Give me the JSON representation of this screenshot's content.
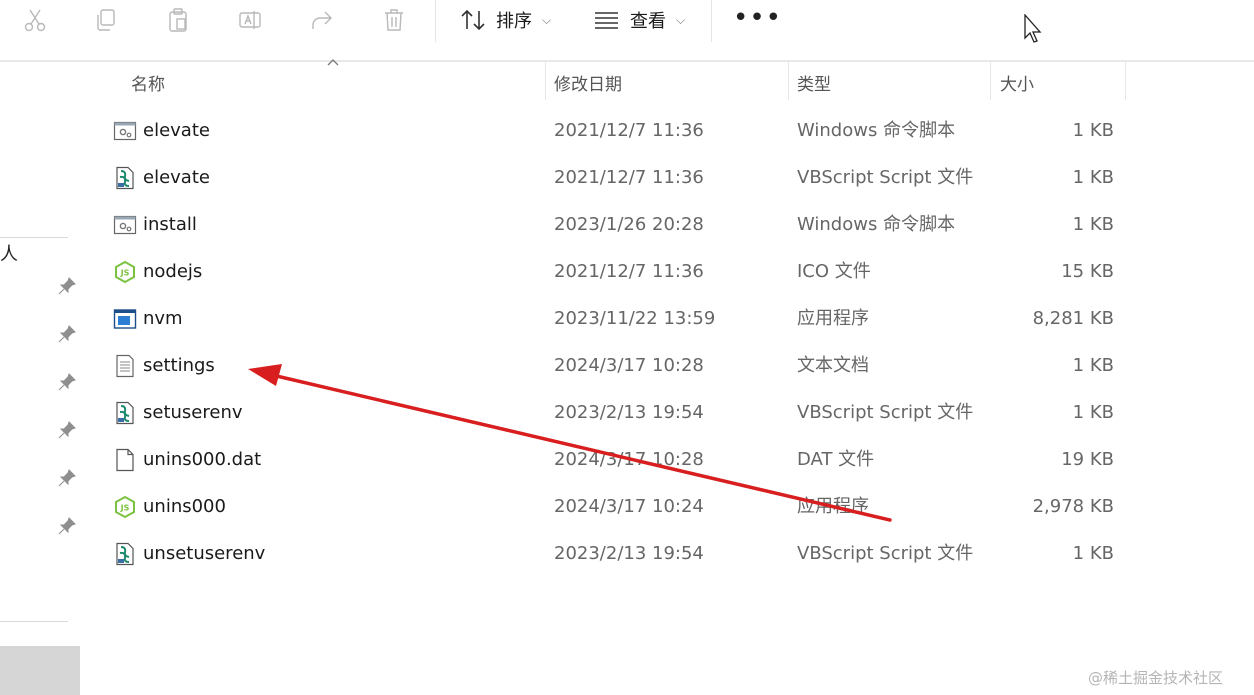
{
  "toolbar": {
    "sort_label": "排序",
    "view_label": "查看",
    "more_label": "•••",
    "dropdown_glyph": "⌵",
    "icons": [
      "cut-icon",
      "copy-icon",
      "paste-icon",
      "rename-icon",
      "share-icon",
      "delete-icon"
    ]
  },
  "nav": {
    "fragment_label": "人"
  },
  "columns": {
    "name": "名称",
    "modified": "修改日期",
    "type": "类型",
    "size": "大小"
  },
  "files": [
    {
      "name": "elevate",
      "modified": "2021/12/7 11:36",
      "type": "Windows 命令脚本",
      "size": "1 KB",
      "icon": "batch-file-icon"
    },
    {
      "name": "elevate",
      "modified": "2021/12/7 11:36",
      "type": "VBScript Script 文件",
      "size": "1 KB",
      "icon": "vbscript-file-icon"
    },
    {
      "name": "install",
      "modified": "2023/1/26 20:28",
      "type": "Windows 命令脚本",
      "size": "1 KB",
      "icon": "batch-file-icon"
    },
    {
      "name": "nodejs",
      "modified": "2021/12/7 11:36",
      "type": "ICO 文件",
      "size": "15 KB",
      "icon": "nodejs-icon"
    },
    {
      "name": "nvm",
      "modified": "2023/11/22 13:59",
      "type": "应用程序",
      "size": "8,281 KB",
      "icon": "application-icon"
    },
    {
      "name": "settings",
      "modified": "2024/3/17 10:28",
      "type": "文本文档",
      "size": "1 KB",
      "icon": "text-file-icon"
    },
    {
      "name": "setuserenv",
      "modified": "2023/2/13 19:54",
      "type": "VBScript Script 文件",
      "size": "1 KB",
      "icon": "vbscript-file-icon"
    },
    {
      "name": "unins000.dat",
      "modified": "2024/3/17 10:28",
      "type": "DAT 文件",
      "size": "19 KB",
      "icon": "blank-file-icon"
    },
    {
      "name": "unins000",
      "modified": "2024/3/17 10:24",
      "type": "应用程序",
      "size": "2,978 KB",
      "icon": "nodejs-icon"
    },
    {
      "name": "unsetuserenv",
      "modified": "2023/2/13 19:54",
      "type": "VBScript Script 文件",
      "size": "1 KB",
      "icon": "vbscript-file-icon"
    }
  ],
  "watermark": "@稀土掘金技术社区",
  "colors": {
    "annotation_arrow": "#d81e1e",
    "nodejs_green": "#7cc242",
    "nav_selected": "#d6d6d6"
  }
}
